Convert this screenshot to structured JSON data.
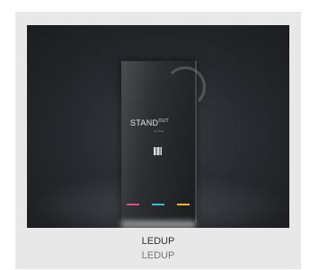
{
  "product": {
    "image_alt": "LEDUP totem",
    "totem_brand": "STAND",
    "totem_brand_sup": "OUT",
    "totem_tagline": "by ledup",
    "title": "LEDUP",
    "subtitle": "LEDUP",
    "accent_colors": [
      "#e34b8f",
      "#42b6d6",
      "#e7b53a"
    ]
  }
}
